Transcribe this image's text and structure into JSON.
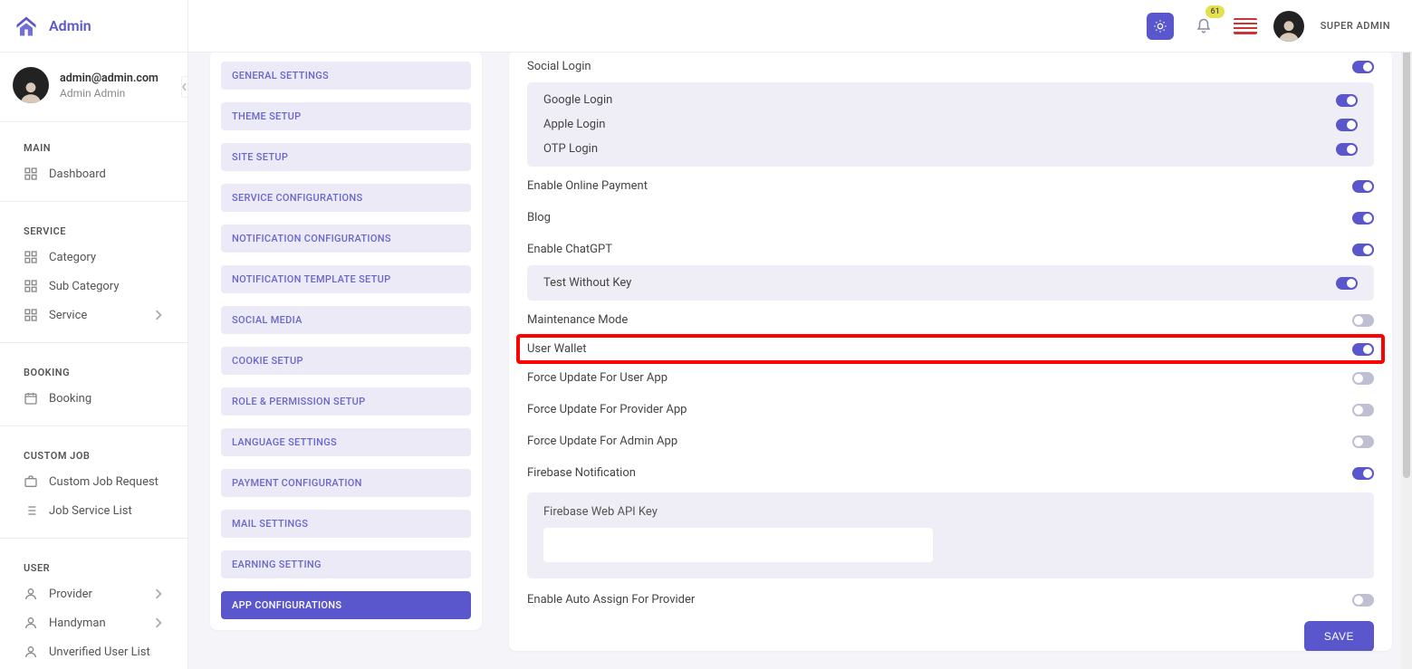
{
  "brand": {
    "name": "Admin"
  },
  "topbar": {
    "notification_count": "61",
    "role": "SUPER ADMIN"
  },
  "profile": {
    "email": "admin@admin.com",
    "name": "Admin Admin"
  },
  "sidebar": {
    "sections": [
      {
        "title": "MAIN",
        "items": [
          {
            "label": "Dashboard",
            "icon": "grid",
            "expand": false
          }
        ]
      },
      {
        "title": "SERVICE",
        "items": [
          {
            "label": "Category",
            "icon": "grid",
            "expand": false
          },
          {
            "label": "Sub Category",
            "icon": "grid",
            "expand": false
          },
          {
            "label": "Service",
            "icon": "grid",
            "expand": true
          }
        ]
      },
      {
        "title": "BOOKING",
        "items": [
          {
            "label": "Booking",
            "icon": "calendar",
            "expand": false
          }
        ]
      },
      {
        "title": "CUSTOM JOB",
        "items": [
          {
            "label": "Custom Job Request",
            "icon": "briefcase",
            "expand": false
          },
          {
            "label": "Job Service List",
            "icon": "list",
            "expand": false
          }
        ]
      },
      {
        "title": "USER",
        "items": [
          {
            "label": "Provider",
            "icon": "person",
            "expand": true
          },
          {
            "label": "Handyman",
            "icon": "person",
            "expand": true
          },
          {
            "label": "Unverified User List",
            "icon": "person",
            "expand": false
          }
        ]
      }
    ]
  },
  "settings_tabs": [
    "GENERAL SETTINGS",
    "THEME SETUP",
    "SITE SETUP",
    "SERVICE CONFIGURATIONS",
    "NOTIFICATION CONFIGURATIONS",
    "NOTIFICATION TEMPLATE SETUP",
    "SOCIAL MEDIA",
    "COOKIE SETUP",
    "ROLE & PERMISSION SETUP",
    "LANGUAGE SETTINGS",
    "PAYMENT CONFIGURATION",
    "MAIL SETTINGS",
    "EARNING SETTING",
    "APP CONFIGURATIONS"
  ],
  "settings_active_tab": "APP CONFIGURATIONS",
  "config": {
    "top": {
      "label": "Social Login",
      "on": true
    },
    "socials": [
      {
        "label": "Google Login",
        "on": true
      },
      {
        "label": "Apple Login",
        "on": true
      },
      {
        "label": "OTP Login",
        "on": true
      }
    ],
    "rows1": [
      {
        "label": "Enable Online Payment",
        "on": true
      },
      {
        "label": "Blog",
        "on": true
      },
      {
        "label": "Enable ChatGPT",
        "on": true
      }
    ],
    "chatgpt_sub": {
      "label": "Test Without Key",
      "on": true
    },
    "rows2": [
      {
        "label": "Maintenance Mode",
        "on": false
      },
      {
        "label": "User Wallet",
        "on": true,
        "highlight": true
      },
      {
        "label": "Force Update For User App",
        "on": false
      },
      {
        "label": "Force Update For Provider App",
        "on": false
      },
      {
        "label": "Force Update For Admin App",
        "on": false
      },
      {
        "label": "Firebase Notification",
        "on": true
      }
    ],
    "firebase_key_label": "Firebase Web API Key",
    "rows3": [
      {
        "label": "Enable Auto Assign For Provider",
        "on": false
      }
    ],
    "save_label": "SAVE"
  }
}
